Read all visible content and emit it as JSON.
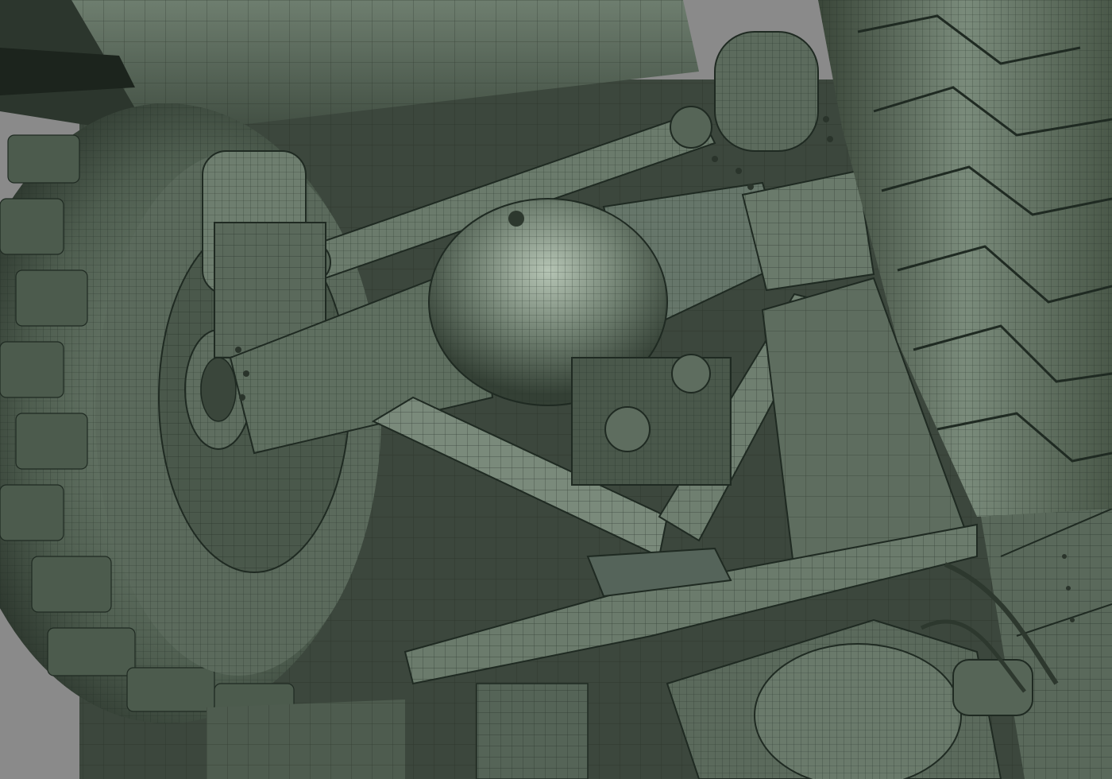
{
  "viewport": {
    "background_color": "#8a8a8a"
  },
  "model": {
    "base_color": "#5e6d5f",
    "shadow_color": "#2f3a31",
    "highlight_color": "#9fb0a0",
    "wire_color": "#1f2a22"
  }
}
